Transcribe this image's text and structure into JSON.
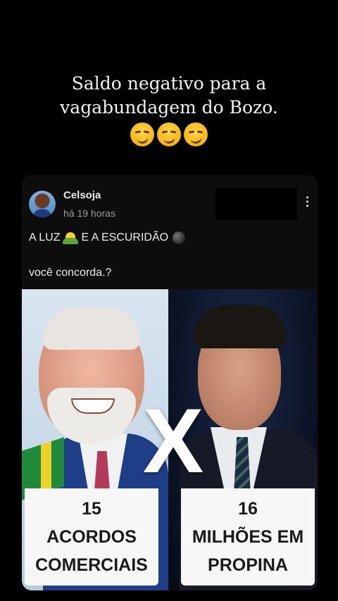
{
  "caption": {
    "line1": "Saldo negativo para a",
    "line2": "vagabundagem do Bozo.",
    "emojis": [
      "smirking-face",
      "smirking-face",
      "smirking-face"
    ]
  },
  "post": {
    "author": "Celsoja",
    "time": "há 19 horas",
    "text_part1": "A LUZ",
    "text_part2": "E A ESCURIDÃO",
    "question": "você concorda.?"
  },
  "image": {
    "versus": "X",
    "left_number": "15",
    "left_line1": "ACORDOS",
    "left_line2": "COMERCIAIS",
    "right_number": "16",
    "right_line1": "MILHÕES EM",
    "right_line2": "PROPINA"
  }
}
